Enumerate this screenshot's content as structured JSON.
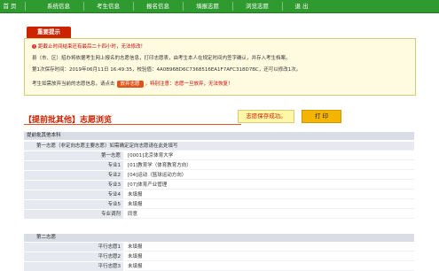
{
  "nav": {
    "items": [
      {
        "label": "首  页"
      },
      {
        "label": "系统信息"
      },
      {
        "label": "考生信息"
      },
      {
        "label": "报名信息"
      },
      {
        "label": "填报志愿"
      },
      {
        "label": "浏览志愿"
      },
      {
        "label": "退  出"
      }
    ]
  },
  "notice": {
    "tab_label": "重要提示",
    "line1": "距截止时间结束还有最后二十四小时，无法修改！",
    "line2": "县（市、区）招办将依据考生网上报名的志愿信息，打印志愿表，由考生本人在规定时间内签字确认，并存入考生档案。",
    "line3": "第1次保存时间：2019年06月11日 16:49:35，校验值：4A0B96BD6C7368516EA1F7AFC318D7BC，还可以修改1次。",
    "line4_prefix": "考生如需放弃当前的志愿信息，请点击",
    "drop_button": "放弃志愿",
    "line4_suffix": "，特别注意：志愿一旦放弃，无法恢复！"
  },
  "section": {
    "title": "【提前批其他】志愿浏览",
    "saved_message": "志愿保存成功。",
    "print_button": "打 印"
  },
  "table": {
    "header": "提前批其他本科",
    "first_choice_label": "第一志愿（非定向志愿主要志愿）如需确定定向志愿请在此处填写",
    "rows": [
      {
        "label": "第一志愿",
        "value": "[0001]北京体育大学"
      },
      {
        "label": "专业1",
        "value": "[01]教育学（体育教育方向）"
      },
      {
        "label": "专业2",
        "value": "[04]运动（篮球运动方向）"
      },
      {
        "label": "专业3",
        "value": "[07]体育产业管理"
      },
      {
        "label": "专业4",
        "value": "未填报"
      },
      {
        "label": "专业5",
        "value": "未填报"
      },
      {
        "label": "专业调剂",
        "value": "同意"
      }
    ],
    "second_section": "第二志愿",
    "parallel_rows": [
      {
        "label": "平行志愿1",
        "value": "未填报"
      },
      {
        "label": "平行志愿2",
        "value": "未填报"
      },
      {
        "label": "平行志愿3",
        "value": "未填报"
      }
    ]
  }
}
